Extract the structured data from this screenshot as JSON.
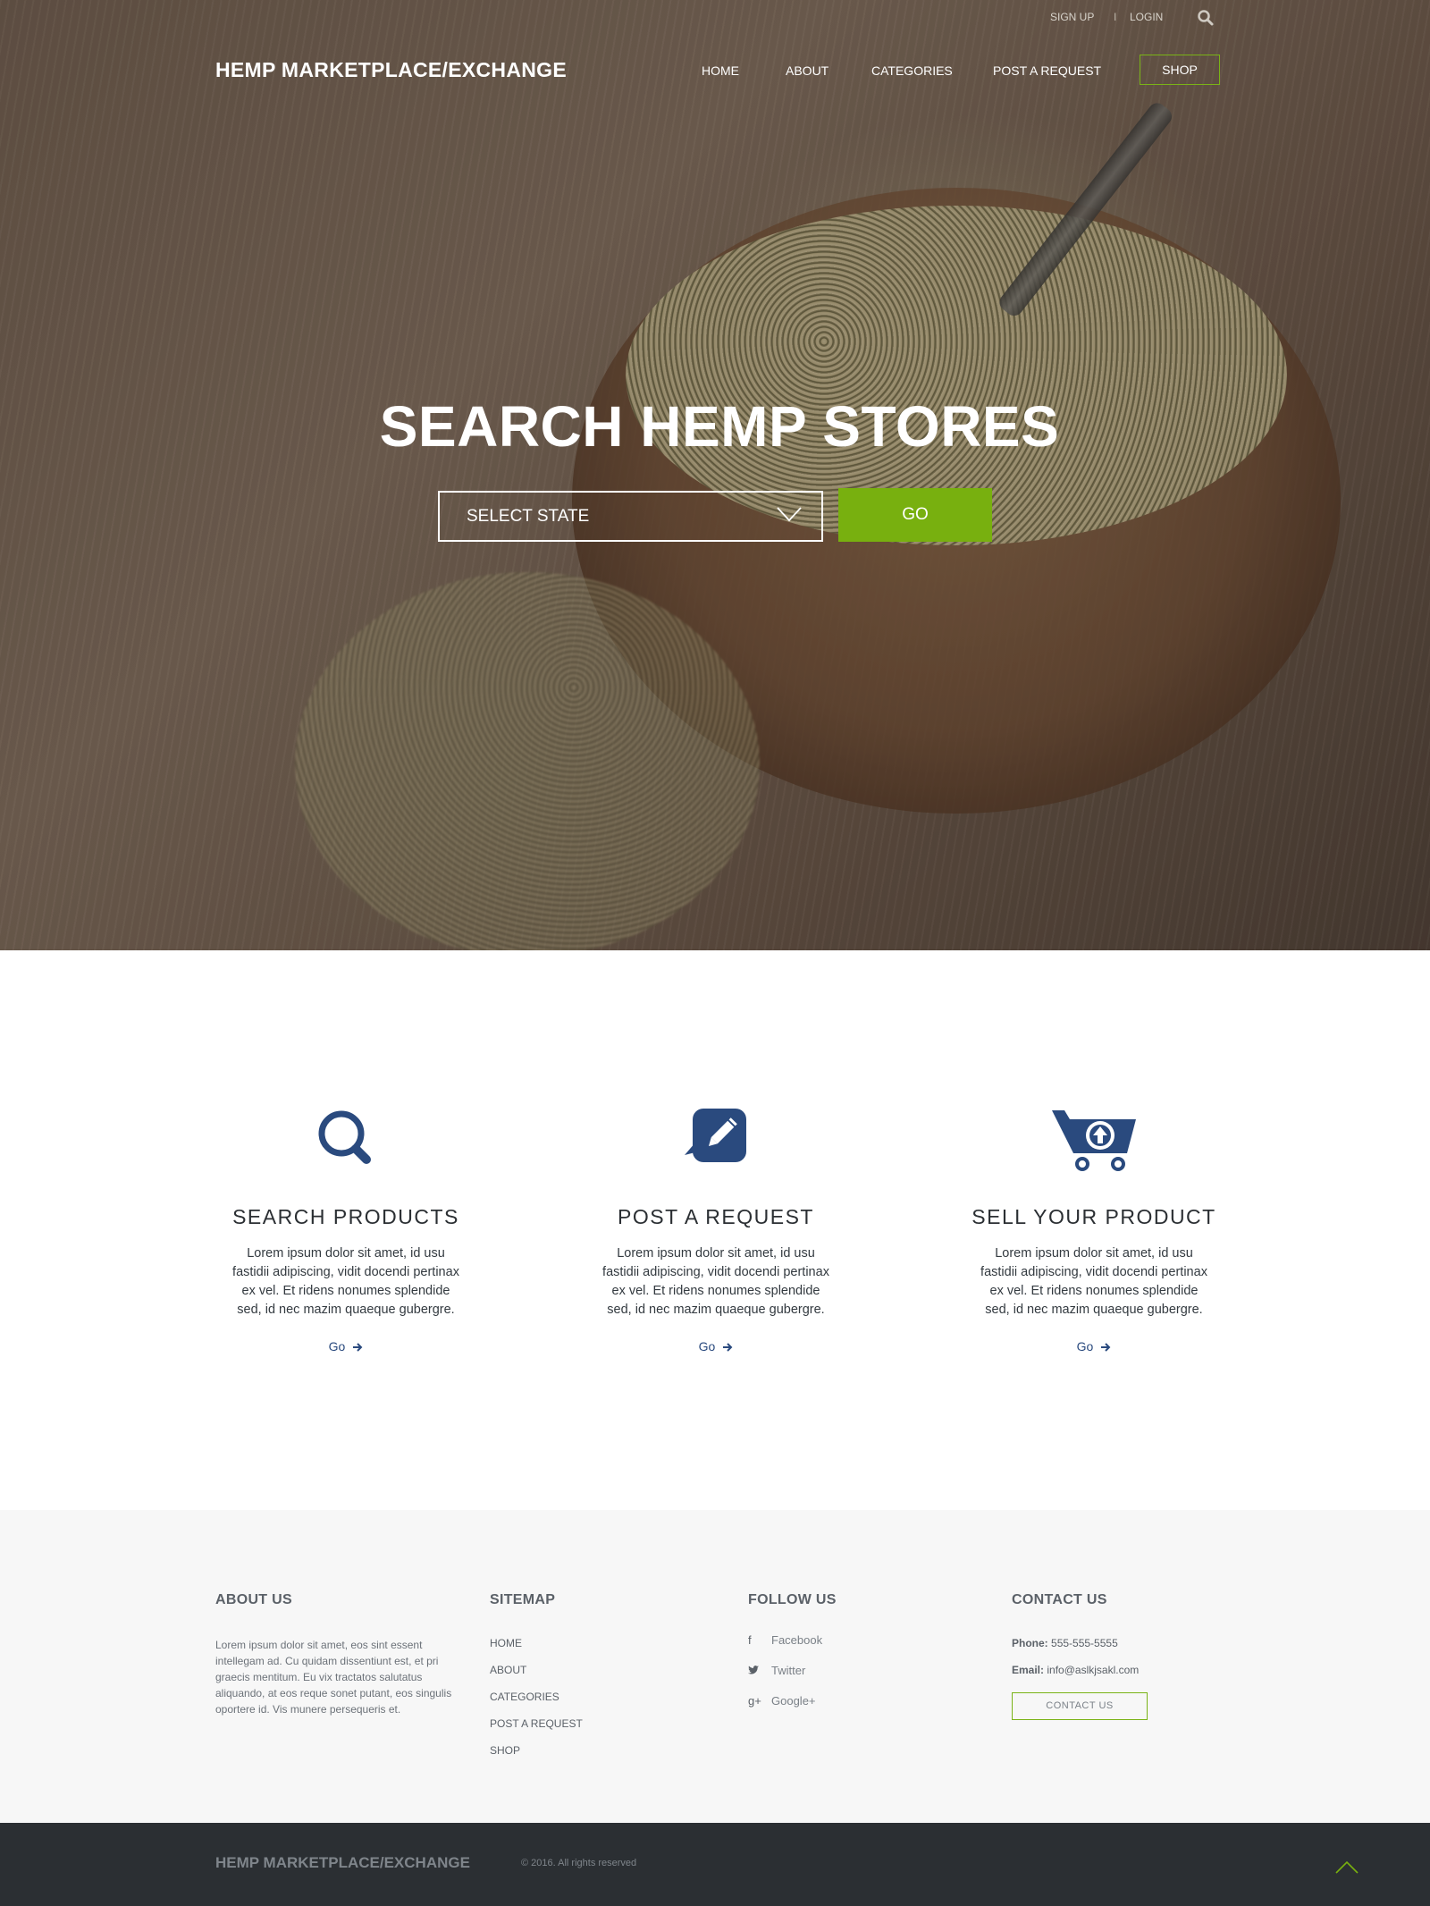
{
  "topbar": {
    "signup": "SIGN UP",
    "separator": "I",
    "login": "LOGIN"
  },
  "header": {
    "brand": "HEMP MARKETPLACE/EXCHANGE",
    "nav": [
      "HOME",
      "ABOUT",
      "CATEGORIES",
      "POST A REQUEST"
    ],
    "shop": "SHOP"
  },
  "hero": {
    "title": "SEARCH HEMP STORES",
    "select_value": "SELECT STATE",
    "go": "GO"
  },
  "features": [
    {
      "icon": "magnifier-icon",
      "title": "SEARCH PRODUCTS",
      "text": "Lorem ipsum dolor sit amet, id usu fastidii adipiscing, vidit docendi pertinax ex vel. Et ridens nonumes splendide sed, id nec mazim quaeque gubergre.",
      "link": "Go"
    },
    {
      "icon": "pencil-bubble-icon",
      "title": "POST A REQUEST",
      "text": "Lorem ipsum dolor sit amet, id usu fastidii adipiscing, vidit docendi pertinax ex vel. Et ridens nonumes splendide sed, id nec mazim quaeque gubergre.",
      "link": "Go"
    },
    {
      "icon": "cart-upload-icon",
      "title": "SELL YOUR PRODUCT",
      "text": "Lorem ipsum dolor sit amet, id usu fastidii adipiscing, vidit docendi pertinax ex vel. Et ridens nonumes splendide sed, id nec mazim quaeque gubergre.",
      "link": "Go"
    }
  ],
  "footer": {
    "about": {
      "heading": "ABOUT US",
      "text": "Lorem ipsum dolor sit amet, eos sint essent intellegam ad. Cu quidam dissentiunt est, et pri graecis mentitum. Eu vix tractatos salutatus aliquando, at eos reque sonet putant, eos singulis oportere id. Vis munere persequeris et."
    },
    "sitemap": {
      "heading": "SITEMAP",
      "items": [
        "HOME",
        "ABOUT",
        "CATEGORIES",
        "POST A REQUEST",
        "SHOP"
      ]
    },
    "follow": {
      "heading": "FOLLOW US",
      "items": [
        {
          "icon": "facebook-icon",
          "label": "Facebook"
        },
        {
          "icon": "twitter-icon",
          "label": "Twitter"
        },
        {
          "icon": "google-plus-icon",
          "label": "Google+"
        }
      ]
    },
    "contact": {
      "heading": "CONTACT US",
      "phone_label": "Phone:",
      "phone": "555-555-5555",
      "email_label": "Email:",
      "email": "info@aslkjsakl.com",
      "button": "CONTACT US"
    }
  },
  "bottombar": {
    "brand": "HEMP MARKETPLACE/EXCHANGE",
    "copyright": "© 2016. All rights reserved"
  },
  "colors": {
    "accent_green": "#78b00f",
    "icon_blue": "#2a4a7e",
    "footer_dark": "#2b2f33"
  }
}
